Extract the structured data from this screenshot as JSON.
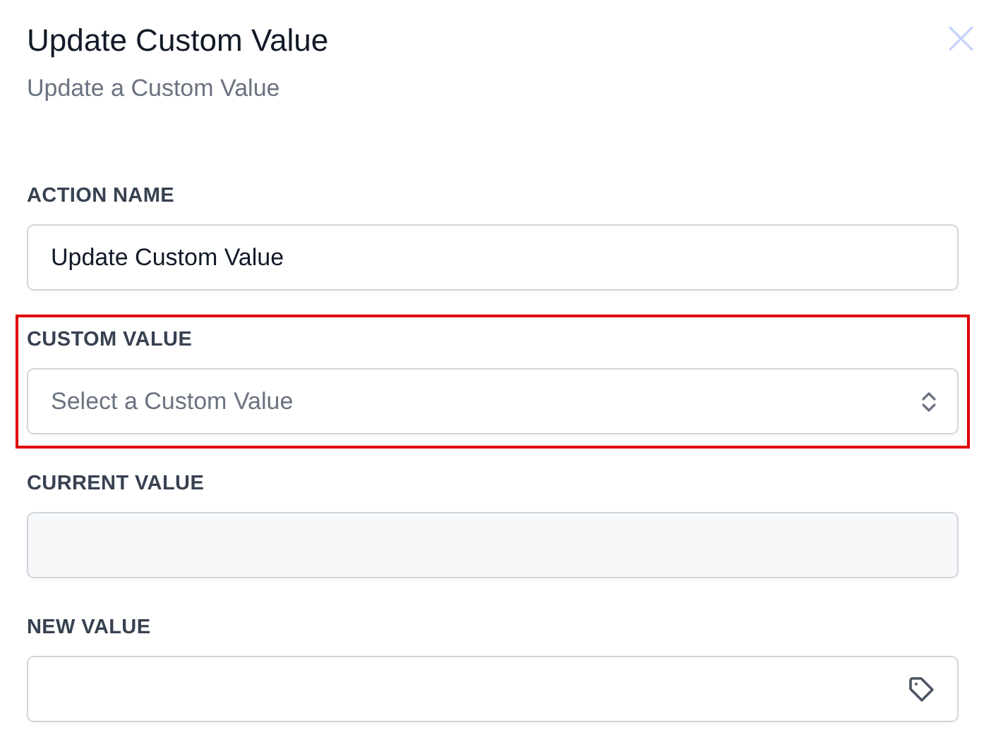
{
  "dialog": {
    "title": "Update Custom Value",
    "subtitle": "Update a Custom Value",
    "close_icon": "×"
  },
  "fields": [
    {
      "label": "ACTION NAME",
      "kind": "text",
      "value": "Update Custom Value",
      "highlighted": false
    },
    {
      "label": "CUSTOM VALUE",
      "kind": "select",
      "placeholder": "Select a Custom Value",
      "highlighted": true
    },
    {
      "label": "CURRENT VALUE",
      "kind": "readonly",
      "highlighted": false
    },
    {
      "label": "NEW VALUE",
      "kind": "tag",
      "highlighted": false
    }
  ]
}
